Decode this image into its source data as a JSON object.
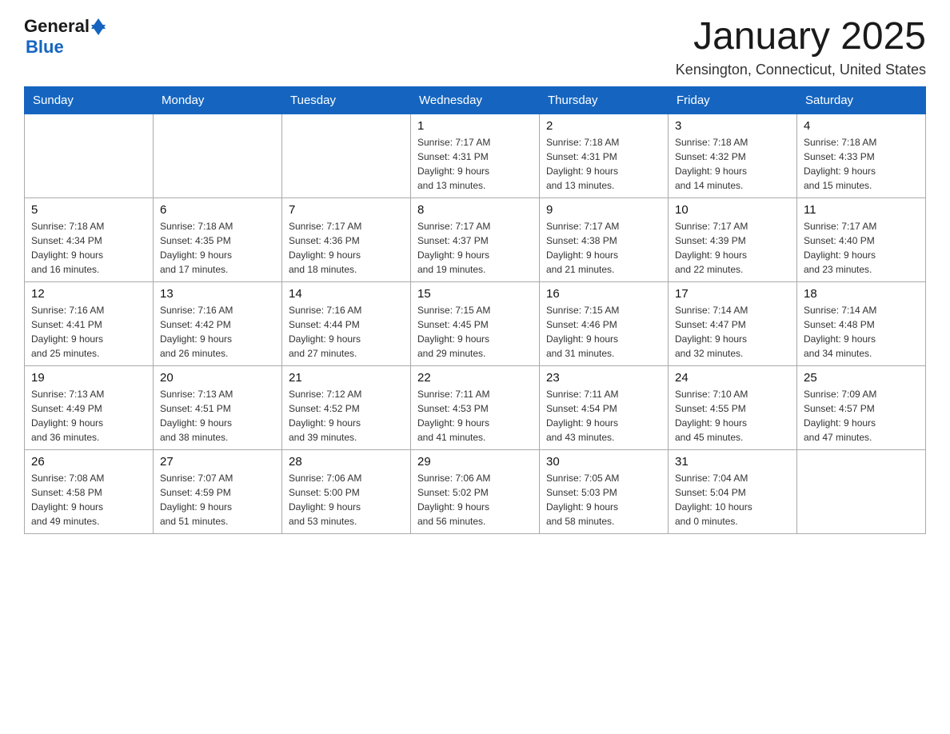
{
  "header": {
    "logo_general": "General",
    "logo_blue": "Blue",
    "month_title": "January 2025",
    "location": "Kensington, Connecticut, United States"
  },
  "days_of_week": [
    "Sunday",
    "Monday",
    "Tuesday",
    "Wednesday",
    "Thursday",
    "Friday",
    "Saturday"
  ],
  "weeks": [
    [
      {
        "day": "",
        "info": ""
      },
      {
        "day": "",
        "info": ""
      },
      {
        "day": "",
        "info": ""
      },
      {
        "day": "1",
        "info": "Sunrise: 7:17 AM\nSunset: 4:31 PM\nDaylight: 9 hours\nand 13 minutes."
      },
      {
        "day": "2",
        "info": "Sunrise: 7:18 AM\nSunset: 4:31 PM\nDaylight: 9 hours\nand 13 minutes."
      },
      {
        "day": "3",
        "info": "Sunrise: 7:18 AM\nSunset: 4:32 PM\nDaylight: 9 hours\nand 14 minutes."
      },
      {
        "day": "4",
        "info": "Sunrise: 7:18 AM\nSunset: 4:33 PM\nDaylight: 9 hours\nand 15 minutes."
      }
    ],
    [
      {
        "day": "5",
        "info": "Sunrise: 7:18 AM\nSunset: 4:34 PM\nDaylight: 9 hours\nand 16 minutes."
      },
      {
        "day": "6",
        "info": "Sunrise: 7:18 AM\nSunset: 4:35 PM\nDaylight: 9 hours\nand 17 minutes."
      },
      {
        "day": "7",
        "info": "Sunrise: 7:17 AM\nSunset: 4:36 PM\nDaylight: 9 hours\nand 18 minutes."
      },
      {
        "day": "8",
        "info": "Sunrise: 7:17 AM\nSunset: 4:37 PM\nDaylight: 9 hours\nand 19 minutes."
      },
      {
        "day": "9",
        "info": "Sunrise: 7:17 AM\nSunset: 4:38 PM\nDaylight: 9 hours\nand 21 minutes."
      },
      {
        "day": "10",
        "info": "Sunrise: 7:17 AM\nSunset: 4:39 PM\nDaylight: 9 hours\nand 22 minutes."
      },
      {
        "day": "11",
        "info": "Sunrise: 7:17 AM\nSunset: 4:40 PM\nDaylight: 9 hours\nand 23 minutes."
      }
    ],
    [
      {
        "day": "12",
        "info": "Sunrise: 7:16 AM\nSunset: 4:41 PM\nDaylight: 9 hours\nand 25 minutes."
      },
      {
        "day": "13",
        "info": "Sunrise: 7:16 AM\nSunset: 4:42 PM\nDaylight: 9 hours\nand 26 minutes."
      },
      {
        "day": "14",
        "info": "Sunrise: 7:16 AM\nSunset: 4:44 PM\nDaylight: 9 hours\nand 27 minutes."
      },
      {
        "day": "15",
        "info": "Sunrise: 7:15 AM\nSunset: 4:45 PM\nDaylight: 9 hours\nand 29 minutes."
      },
      {
        "day": "16",
        "info": "Sunrise: 7:15 AM\nSunset: 4:46 PM\nDaylight: 9 hours\nand 31 minutes."
      },
      {
        "day": "17",
        "info": "Sunrise: 7:14 AM\nSunset: 4:47 PM\nDaylight: 9 hours\nand 32 minutes."
      },
      {
        "day": "18",
        "info": "Sunrise: 7:14 AM\nSunset: 4:48 PM\nDaylight: 9 hours\nand 34 minutes."
      }
    ],
    [
      {
        "day": "19",
        "info": "Sunrise: 7:13 AM\nSunset: 4:49 PM\nDaylight: 9 hours\nand 36 minutes."
      },
      {
        "day": "20",
        "info": "Sunrise: 7:13 AM\nSunset: 4:51 PM\nDaylight: 9 hours\nand 38 minutes."
      },
      {
        "day": "21",
        "info": "Sunrise: 7:12 AM\nSunset: 4:52 PM\nDaylight: 9 hours\nand 39 minutes."
      },
      {
        "day": "22",
        "info": "Sunrise: 7:11 AM\nSunset: 4:53 PM\nDaylight: 9 hours\nand 41 minutes."
      },
      {
        "day": "23",
        "info": "Sunrise: 7:11 AM\nSunset: 4:54 PM\nDaylight: 9 hours\nand 43 minutes."
      },
      {
        "day": "24",
        "info": "Sunrise: 7:10 AM\nSunset: 4:55 PM\nDaylight: 9 hours\nand 45 minutes."
      },
      {
        "day": "25",
        "info": "Sunrise: 7:09 AM\nSunset: 4:57 PM\nDaylight: 9 hours\nand 47 minutes."
      }
    ],
    [
      {
        "day": "26",
        "info": "Sunrise: 7:08 AM\nSunset: 4:58 PM\nDaylight: 9 hours\nand 49 minutes."
      },
      {
        "day": "27",
        "info": "Sunrise: 7:07 AM\nSunset: 4:59 PM\nDaylight: 9 hours\nand 51 minutes."
      },
      {
        "day": "28",
        "info": "Sunrise: 7:06 AM\nSunset: 5:00 PM\nDaylight: 9 hours\nand 53 minutes."
      },
      {
        "day": "29",
        "info": "Sunrise: 7:06 AM\nSunset: 5:02 PM\nDaylight: 9 hours\nand 56 minutes."
      },
      {
        "day": "30",
        "info": "Sunrise: 7:05 AM\nSunset: 5:03 PM\nDaylight: 9 hours\nand 58 minutes."
      },
      {
        "day": "31",
        "info": "Sunrise: 7:04 AM\nSunset: 5:04 PM\nDaylight: 10 hours\nand 0 minutes."
      },
      {
        "day": "",
        "info": ""
      }
    ]
  ]
}
